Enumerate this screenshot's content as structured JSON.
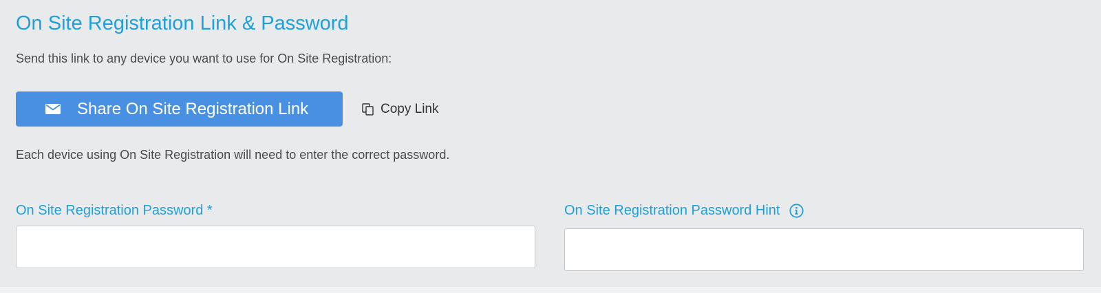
{
  "section": {
    "title": "On Site Registration Link & Password",
    "intro": "Send this link to any device you want to use for On Site Registration:",
    "note": "Each device using On Site Registration will need to enter the correct password."
  },
  "actions": {
    "share_label": "Share On Site Registration Link",
    "share_icon": "mail-icon",
    "copy_label": "Copy Link",
    "copy_icon": "copy-icon"
  },
  "fields": {
    "password": {
      "label": "On Site Registration Password *",
      "value": "",
      "placeholder": ""
    },
    "hint": {
      "label": "On Site Registration Password Hint",
      "info_icon": "info-icon",
      "value": "",
      "placeholder": ""
    }
  },
  "colors": {
    "accent": "#1ea0d9",
    "button": "#4a90e2",
    "panel": "#e9eaec"
  }
}
